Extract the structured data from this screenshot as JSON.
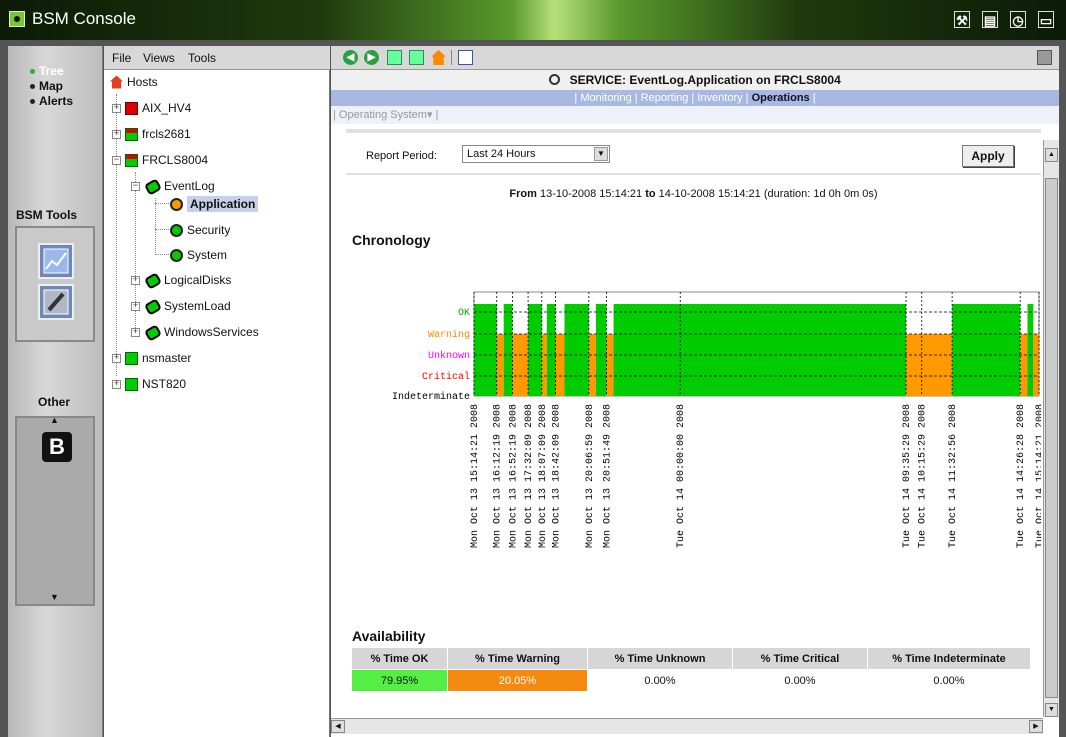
{
  "window": {
    "title": "BSM Console"
  },
  "titlebar_icons": [
    "tools-icon",
    "document-icon",
    "clock-icon",
    "screen-icon"
  ],
  "leftnav": {
    "links": [
      "Tree",
      "Map",
      "Alerts"
    ],
    "active": "Tree",
    "bsm_tools_label": "BSM Tools",
    "other_label": "Other"
  },
  "tree_menu": {
    "file": "File",
    "views": "Views",
    "tools": "Tools"
  },
  "tree": {
    "root": "Hosts",
    "hosts": [
      "AIX_HV4",
      "frcls2681",
      "FRCLS8004",
      "nsmaster",
      "NST820"
    ],
    "frcls8004_children": [
      "EventLog",
      "LogicalDisks",
      "SystemLoad",
      "WindowsServices"
    ],
    "eventlog_children": [
      "Application",
      "Security",
      "System"
    ],
    "selected": "Application"
  },
  "service_header": "SERVICE: EventLog.Application on FRCLS8004",
  "tabs": {
    "items": [
      "Monitoring",
      "Reporting",
      "Inventory",
      "Operations"
    ],
    "active": "Operations"
  },
  "subtab": "Operating System",
  "report": {
    "period_label": "Report Period:",
    "period_value": "Last 24 Hours",
    "apply": "Apply",
    "range_from_label": "From",
    "range_from": "13-10-2008 15:14:21",
    "range_to_label": "to",
    "range_to": "14-10-2008 15:14:21",
    "range_duration": "(duration: 1d 0h 0m 0s)"
  },
  "chronology_title": "Chronology",
  "chart_data": {
    "type": "bar",
    "title": "",
    "states": [
      "OK",
      "Warning",
      "Unknown",
      "Critical",
      "Indeterminate"
    ],
    "state_colors": {
      "OK": "#00cc00",
      "Warning": "#ff9900",
      "Unknown": "#ff00ff",
      "Critical": "#ff0000",
      "Indeterminate": "#000000"
    },
    "x_range": [
      "Mon Oct 13 15:14:21 2008",
      "Tue Oct 14 15:14:21 2008"
    ],
    "tick_labels": [
      "Mon Oct 13 15:14:21 2008",
      "Mon Oct 13 16:12:19 2008",
      "Mon Oct 13 16:52:19 2008",
      "Mon Oct 13 17:32:09 2008",
      "Mon Oct 13 18:07:09 2008",
      "Mon Oct 13 18:42:09 2008",
      "Mon Oct 13 20:06:59 2008",
      "Mon Oct 13 20:51:49 2008",
      "Tue Oct 14 00:00:00 2008",
      "Tue Oct 14 09:35:29 2008",
      "Tue Oct 14 10:15:29 2008",
      "Tue Oct 14 11:32:56 2008",
      "Tue Oct 14 14:26:28 2008",
      "Tue Oct 14 15:14:21 2008"
    ],
    "segments": [
      {
        "start": "Mon Oct 13 15:14:21 2008",
        "end": "Mon Oct 13 16:12:19 2008",
        "state": "OK"
      },
      {
        "start": "Mon Oct 13 16:12:19 2008",
        "end": "Mon Oct 13 16:30:00 2008",
        "state": "Warning"
      },
      {
        "start": "Mon Oct 13 16:30:00 2008",
        "end": "Mon Oct 13 16:52:19 2008",
        "state": "OK"
      },
      {
        "start": "Mon Oct 13 16:52:19 2008",
        "end": "Mon Oct 13 17:32:09 2008",
        "state": "Warning"
      },
      {
        "start": "Mon Oct 13 17:32:09 2008",
        "end": "Mon Oct 13 18:07:09 2008",
        "state": "OK"
      },
      {
        "start": "Mon Oct 13 18:07:09 2008",
        "end": "Mon Oct 13 18:20:00 2008",
        "state": "Warning"
      },
      {
        "start": "Mon Oct 13 18:20:00 2008",
        "end": "Mon Oct 13 18:42:09 2008",
        "state": "OK"
      },
      {
        "start": "Mon Oct 13 18:42:09 2008",
        "end": "Mon Oct 13 19:05:00 2008",
        "state": "Warning"
      },
      {
        "start": "Mon Oct 13 19:05:00 2008",
        "end": "Mon Oct 13 20:06:59 2008",
        "state": "OK"
      },
      {
        "start": "Mon Oct 13 20:06:59 2008",
        "end": "Mon Oct 13 20:25:00 2008",
        "state": "Warning"
      },
      {
        "start": "Mon Oct 13 20:25:00 2008",
        "end": "Mon Oct 13 20:51:49 2008",
        "state": "OK"
      },
      {
        "start": "Mon Oct 13 20:51:49 2008",
        "end": "Mon Oct 13 21:10:00 2008",
        "state": "Warning"
      },
      {
        "start": "Mon Oct 13 21:10:00 2008",
        "end": "Tue Oct 14 09:35:29 2008",
        "state": "OK"
      },
      {
        "start": "Tue Oct 14 09:35:29 2008",
        "end": "Tue Oct 14 11:32:56 2008",
        "state": "Warning"
      },
      {
        "start": "Tue Oct 14 11:32:56 2008",
        "end": "Tue Oct 14 14:26:28 2008",
        "state": "OK"
      },
      {
        "start": "Tue Oct 14 14:26:28 2008",
        "end": "Tue Oct 14 14:45:00 2008",
        "state": "Warning"
      },
      {
        "start": "Tue Oct 14 14:45:00 2008",
        "end": "Tue Oct 14 15:00:00 2008",
        "state": "OK"
      },
      {
        "start": "Tue Oct 14 15:00:00 2008",
        "end": "Tue Oct 14 15:14:21 2008",
        "state": "Warning"
      }
    ]
  },
  "availability": {
    "title": "Availability",
    "headers": [
      "% Time OK",
      "% Time Warning",
      "% Time Unknown",
      "% Time Critical",
      "% Time Indeterminate"
    ],
    "values": [
      "79.95%",
      "20.05%",
      "0.00%",
      "0.00%",
      "0.00%"
    ],
    "ok_color": "#55ee44",
    "warning_color": "#f58a10"
  }
}
